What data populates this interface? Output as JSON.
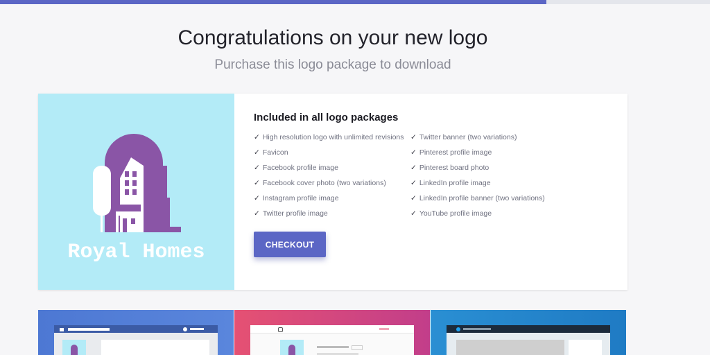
{
  "progress": {
    "value_percent": 77
  },
  "header": {
    "title": "Congratulations on your new logo",
    "subtitle": "Purchase this logo package to download"
  },
  "logo": {
    "text": "Royal Homes",
    "background_color": "#b3ebf7",
    "accent_color": "#8a55a6"
  },
  "package": {
    "heading": "Included in all logo packages",
    "check_glyph": "✓",
    "features_left": [
      "High resolution logo with unlimited revisions",
      "Favicon",
      "Facebook profile image",
      "Facebook cover photo (two variations)",
      "Instagram profile image",
      "Twitter profile image"
    ],
    "features_right": [
      "Twitter banner (two variations)",
      "Pinterest profile image",
      "Pinterest board photo",
      "LinkedIn profile image",
      "LinkedIn profile banner (two variations)",
      "YouTube profile image"
    ],
    "checkout_label": "CHECKOUT"
  },
  "colors": {
    "accent": "#5b66c5",
    "page_bg": "#f6f6f8"
  },
  "previews": [
    "facebook-preview",
    "instagram-preview",
    "twitter-preview"
  ]
}
